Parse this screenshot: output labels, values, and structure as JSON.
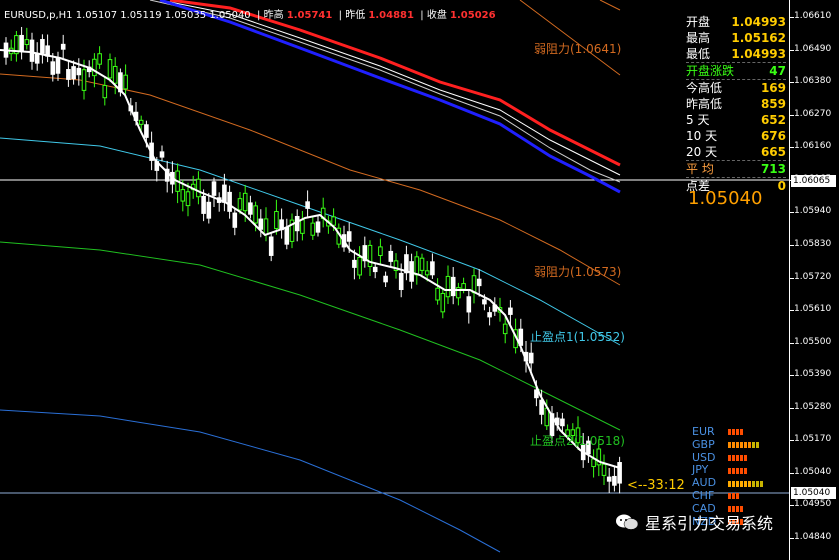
{
  "header": {
    "symbol_ohlc": "EURUSD,p,H1  1.05107 1.05119 1.05035 1.05040",
    "prev_high_label": "昨高",
    "prev_high_value": "1.05741",
    "prev_low_label": "昨低",
    "prev_low_value": "1.04881",
    "close_label": "收盘",
    "close_value": "1.05026"
  },
  "info_panel": {
    "rows": [
      {
        "label": "开盘",
        "value": "1.04993"
      },
      {
        "label": "最高",
        "value": "1.05162"
      },
      {
        "label": "最低",
        "value": "1.04993"
      },
      {
        "label": "开盘涨跌",
        "value": "47"
      },
      {
        "label": "今高低",
        "value": "169"
      },
      {
        "label": "昨高低",
        "value": "859"
      },
      {
        "label": "5  天",
        "value": "652"
      },
      {
        "label": "10 天",
        "value": "676"
      },
      {
        "label": "20 天",
        "value": "665"
      },
      {
        "label": "平  均",
        "value": "713"
      },
      {
        "label": "点差",
        "value": "0"
      }
    ],
    "current_price": "1.05040"
  },
  "levels": {
    "weak_resistance_1": "弱阻力(1.0641)",
    "weak_resistance_2": "弱阻力(1.0573)",
    "take_profit_1": "止盈点1(1.0552)",
    "take_profit_2": "止盈点2(1.0518)"
  },
  "countdown": "<--33:12",
  "price_axis": {
    "ticks": [
      "1.06610",
      "1.06490",
      "1.06380",
      "1.06270",
      "1.06160",
      "1.06065",
      "1.05940",
      "1.05830",
      "1.05720",
      "1.05610",
      "1.05500",
      "1.05390",
      "1.05280",
      "1.05170",
      "1.05040",
      "1.04950",
      "1.04840"
    ],
    "crosshair_price": "1.06065",
    "current_price": "1.05040"
  },
  "currencies": [
    {
      "name": "EUR",
      "bars": 4,
      "color": "#ff4d00"
    },
    {
      "name": "GBP",
      "bars": 8,
      "color": "#ff8c00"
    },
    {
      "name": "USD",
      "bars": 5,
      "color": "#ff4d00"
    },
    {
      "name": "JPY",
      "bars": 5,
      "color": "#ff4d00"
    },
    {
      "name": "AUD",
      "bars": 9,
      "color": "#ffaa00"
    },
    {
      "name": "CHF",
      "bars": 3,
      "color": "#ff4d00"
    },
    {
      "name": "CAD",
      "bars": 4,
      "color": "#ff4d00"
    },
    {
      "name": "NZD",
      "bars": 4,
      "color": "#ff4d00"
    }
  ],
  "watermark": "星系引力交易系统",
  "colors": {
    "bull_candle": "#39ff14",
    "bear_candle": "#ffffff",
    "ma_fast": "#ffffff",
    "channel_upper": "#ff2020",
    "channel_lower": "#2020ff",
    "resistance_line": "#d26a20",
    "take_profit_line": "#40c8e8",
    "green_line": "#20c020",
    "blue_line": "#2a6fd6"
  }
}
